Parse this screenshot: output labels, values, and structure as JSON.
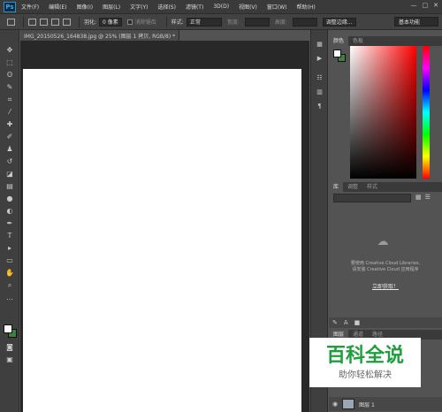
{
  "menubar": {
    "logo": "Ps",
    "items": [
      "文件(F)",
      "编辑(E)",
      "图像(I)",
      "图层(L)",
      "文字(Y)",
      "选择(S)",
      "滤镜(T)",
      "3D(D)",
      "视图(V)",
      "窗口(W)",
      "帮助(H)"
    ],
    "controls": [
      "—",
      "□",
      "✕"
    ]
  },
  "options": {
    "feather_label": "羽化:",
    "feather_value": "0 像素",
    "antialias_label": "消除锯齿",
    "style_label": "样式:",
    "style_value": "正常",
    "width_label": "宽度:",
    "height_label": "高度:",
    "refine_edge": "调整边缘...",
    "workspace": "基本功能"
  },
  "document": {
    "tab_title": "IMG_20150526_164838.jpg @ 25% (图层 1 拷贝, RGB/8) *"
  },
  "panels": {
    "color_tabs": [
      "颜色",
      "色板"
    ],
    "library_tabs": [
      "库",
      "调整",
      "样式"
    ],
    "library_message_1": "要使用 Creative Cloud Libraries,",
    "library_message_2": "请安装 Creative Cloud 应用程序",
    "library_link": "立即获取！",
    "layers_tabs": [
      "图层",
      "通道",
      "路径"
    ],
    "layer_name": "图层 1"
  },
  "watermark": {
    "title": "百科全说",
    "subtitle": "助你轻松解决"
  }
}
